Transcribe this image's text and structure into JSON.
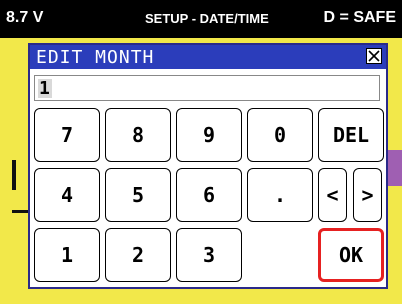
{
  "status": {
    "voltage": "8.7 V",
    "screen": "SETUP - DATE/TIME",
    "mode": "D = SAFE"
  },
  "dialog": {
    "title": "EDIT MONTH",
    "value": "1",
    "close_icon": "close-icon"
  },
  "keys": {
    "row1": [
      "7",
      "8",
      "9",
      "0",
      "DEL"
    ],
    "row2": [
      "4",
      "5",
      "6",
      ".",
      "<",
      ">"
    ],
    "row3": [
      "1",
      "2",
      "3",
      "OK"
    ]
  },
  "colors": {
    "status_bg": "#000000",
    "background": "#f2e84a",
    "title_bar": "#2b3dbb",
    "ok_highlight": "#e62121"
  }
}
